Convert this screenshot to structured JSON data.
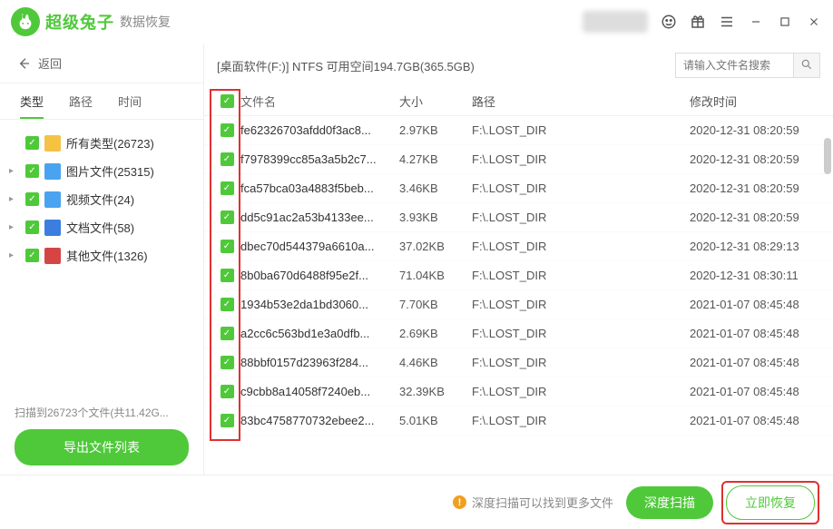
{
  "brand": "超级兔子",
  "subtitle": "数据恢复",
  "back_label": "返回",
  "filter_tabs": {
    "type": "类型",
    "path": "路径",
    "time": "时间"
  },
  "tree": [
    {
      "label": "所有类型(26723)",
      "icon": "folder"
    },
    {
      "label": "图片文件(25315)",
      "icon": "image"
    },
    {
      "label": "视频文件(24)",
      "icon": "video"
    },
    {
      "label": "文档文件(58)",
      "icon": "doc"
    },
    {
      "label": "其他文件(1326)",
      "icon": "other"
    }
  ],
  "scan_status": "扫描到26723个文件(共11.42G...",
  "export_button": "导出文件列表",
  "path_string": "[桌面软件(F:)] NTFS 可用空间194.7GB(365.5GB)",
  "search_placeholder": "请输入文件名搜索",
  "columns": {
    "name": "文件名",
    "size": "大小",
    "path": "路径",
    "mtime": "修改时间"
  },
  "rows": [
    {
      "name": "fe62326703afdd0f3ac8...",
      "size": "2.97KB",
      "path": "F:\\.LOST_DIR",
      "mtime": "2020-12-31 08:20:59"
    },
    {
      "name": "f7978399cc85a3a5b2c7...",
      "size": "4.27KB",
      "path": "F:\\.LOST_DIR",
      "mtime": "2020-12-31 08:20:59"
    },
    {
      "name": "fca57bca03a4883f5beb...",
      "size": "3.46KB",
      "path": "F:\\.LOST_DIR",
      "mtime": "2020-12-31 08:20:59"
    },
    {
      "name": "dd5c91ac2a53b4133ee...",
      "size": "3.93KB",
      "path": "F:\\.LOST_DIR",
      "mtime": "2020-12-31 08:20:59"
    },
    {
      "name": "dbec70d544379a6610a...",
      "size": "37.02KB",
      "path": "F:\\.LOST_DIR",
      "mtime": "2020-12-31 08:29:13"
    },
    {
      "name": "8b0ba670d6488f95e2f...",
      "size": "71.04KB",
      "path": "F:\\.LOST_DIR",
      "mtime": "2020-12-31 08:30:11"
    },
    {
      "name": "1934b53e2da1bd3060...",
      "size": "7.70KB",
      "path": "F:\\.LOST_DIR",
      "mtime": "2021-01-07 08:45:48"
    },
    {
      "name": "a2cc6c563bd1e3a0dfb...",
      "size": "2.69KB",
      "path": "F:\\.LOST_DIR",
      "mtime": "2021-01-07 08:45:48"
    },
    {
      "name": "88bbf0157d23963f284...",
      "size": "4.46KB",
      "path": "F:\\.LOST_DIR",
      "mtime": "2021-01-07 08:45:48"
    },
    {
      "name": "c9cbb8a14058f7240eb...",
      "size": "32.39KB",
      "path": "F:\\.LOST_DIR",
      "mtime": "2021-01-07 08:45:48"
    },
    {
      "name": "83bc4758770732ebee2...",
      "size": "5.01KB",
      "path": "F:\\.LOST_DIR",
      "mtime": "2021-01-07 08:45:48"
    }
  ],
  "deep_tip": "深度扫描可以找到更多文件",
  "deep_scan_button": "深度扫描",
  "recover_button": "立即恢复"
}
